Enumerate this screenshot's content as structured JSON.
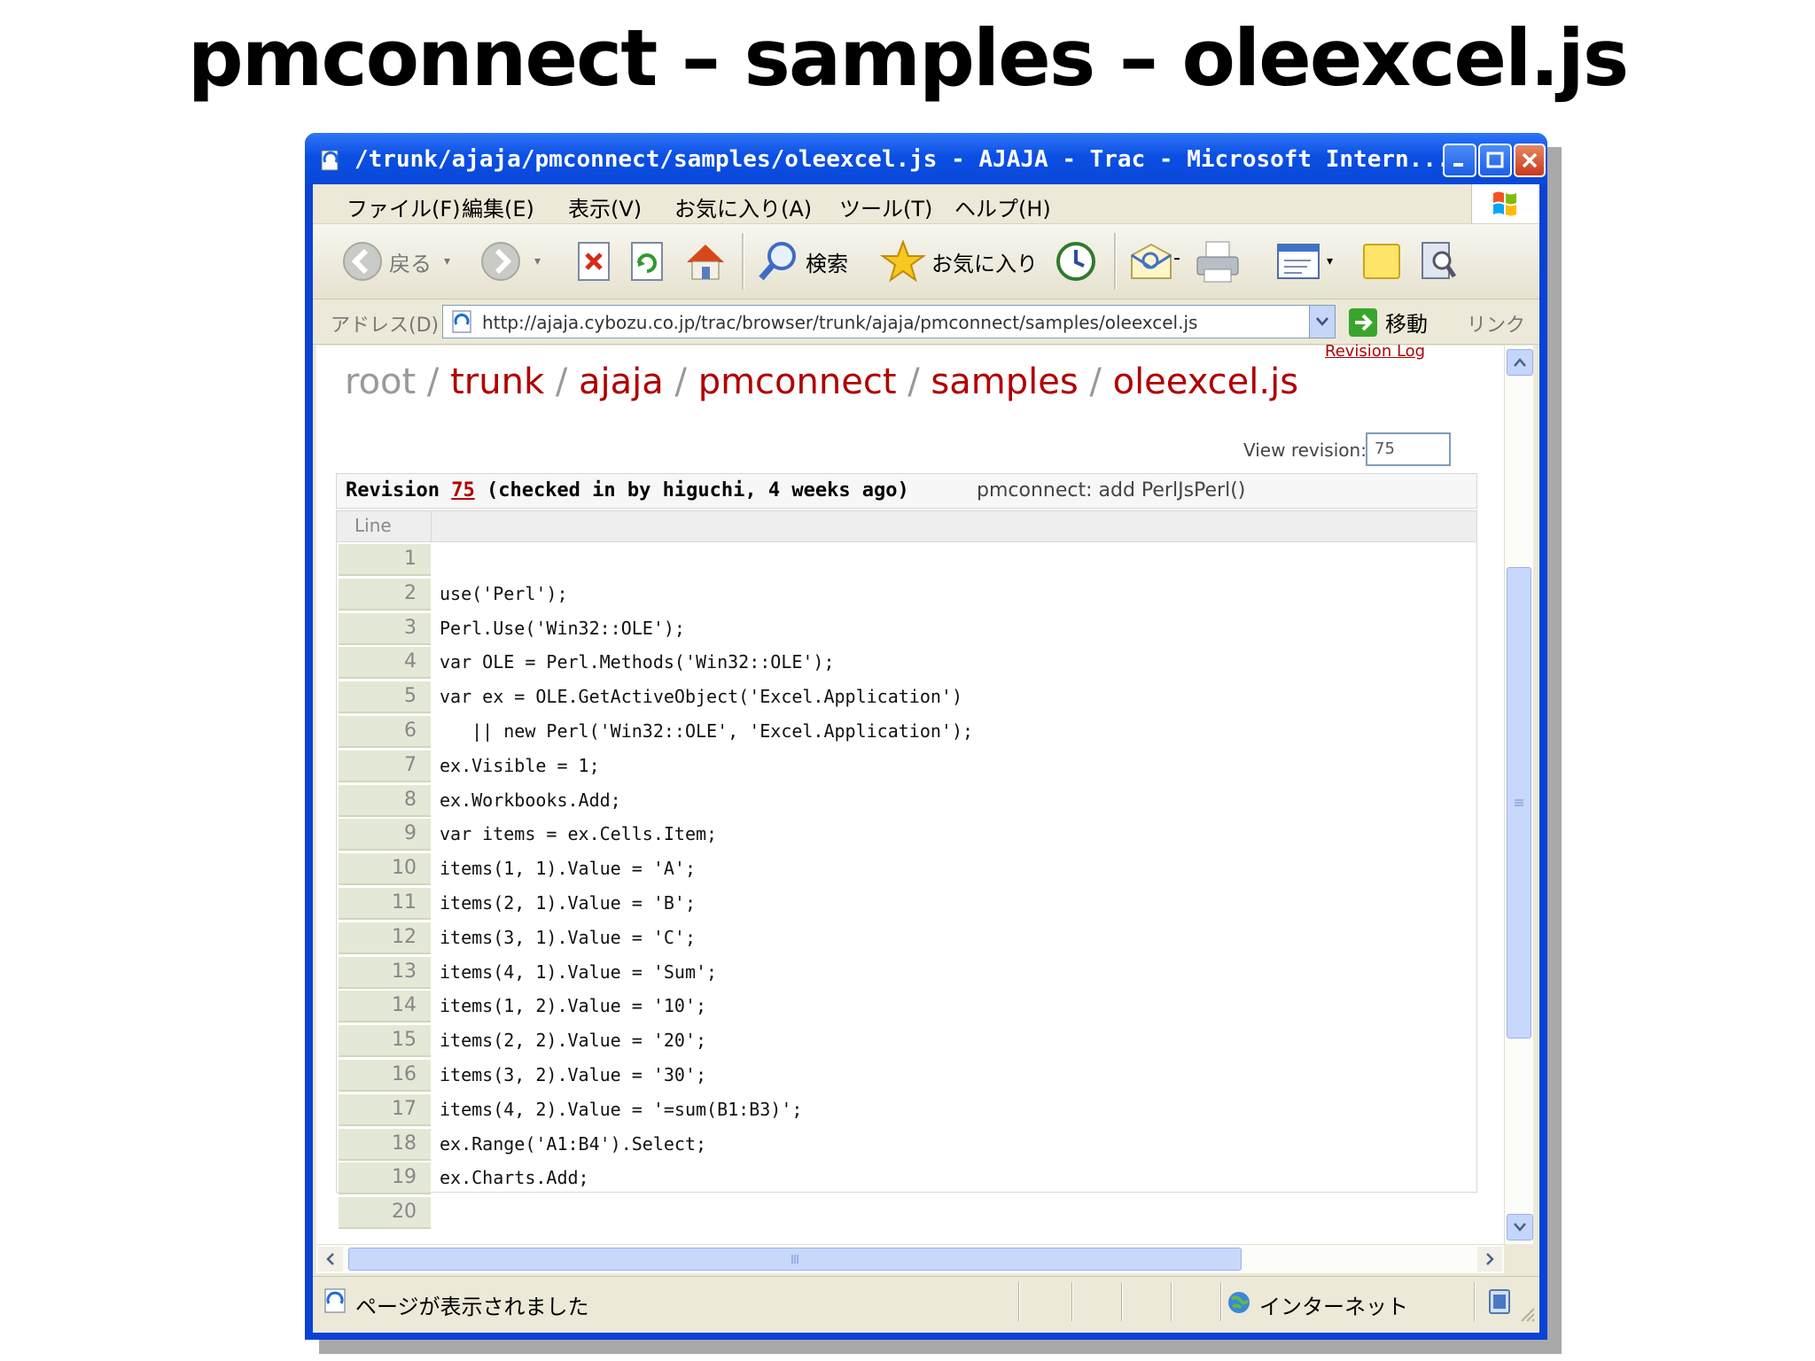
{
  "slide": {
    "title": "pmconnect – samples – oleexcel.js"
  },
  "window": {
    "title": "/trunk/ajaja/pmconnect/samples/oleexcel.js - AJAJA - Trac - Microsoft Intern...",
    "controls": {
      "minimize": "_",
      "maximize": "□",
      "close": "✕"
    }
  },
  "menu": {
    "file": "ファイル(F)",
    "edit": "編集(E)",
    "view": "表示(V)",
    "favorites": "お気に入り(A)",
    "tools": "ツール(T)",
    "help": "ヘルプ(H)"
  },
  "toolbar": {
    "back": "戻る",
    "search": "検索",
    "favorites": "お気に入り"
  },
  "address": {
    "label": "アドレス(D)",
    "url": "http://ajaja.cybozu.co.jp/trac/browser/trunk/ajaja/pmconnect/samples/oleexcel.js",
    "go": "移動",
    "links": "リンク"
  },
  "trac": {
    "revision_log": "Revision Log",
    "breadcrumb": {
      "root": "root",
      "sep": " / ",
      "trunk": "trunk",
      "ajaja": "ajaja",
      "pmconnect": "pmconnect",
      "samples": "samples",
      "file": "oleexcel.js"
    },
    "view_revision_label": "View revision:",
    "view_revision_value": "75",
    "revision": {
      "prefix": "Revision ",
      "number": "75",
      "info": " (checked in by higuchi, 4 weeks ago)",
      "message": "pmconnect: add PerlJsPerl()"
    },
    "line_header": "Line",
    "lines": [
      {
        "n": "1",
        "code": ""
      },
      {
        "n": "2",
        "code": "use('Perl');"
      },
      {
        "n": "3",
        "code": "Perl.Use('Win32::OLE');"
      },
      {
        "n": "4",
        "code": "var OLE = Perl.Methods('Win32::OLE');"
      },
      {
        "n": "5",
        "code": "var ex = OLE.GetActiveObject('Excel.Application')"
      },
      {
        "n": "6",
        "code": "   || new Perl('Win32::OLE', 'Excel.Application');"
      },
      {
        "n": "7",
        "code": "ex.Visible = 1;"
      },
      {
        "n": "8",
        "code": "ex.Workbooks.Add;"
      },
      {
        "n": "9",
        "code": "var items = ex.Cells.Item;"
      },
      {
        "n": "10",
        "code": "items(1, 1).Value = 'A';"
      },
      {
        "n": "11",
        "code": "items(2, 1).Value = 'B';"
      },
      {
        "n": "12",
        "code": "items(3, 1).Value = 'C';"
      },
      {
        "n": "13",
        "code": "items(4, 1).Value = 'Sum';"
      },
      {
        "n": "14",
        "code": "items(1, 2).Value = '10';"
      },
      {
        "n": "15",
        "code": "items(2, 2).Value = '20';"
      },
      {
        "n": "16",
        "code": "items(3, 2).Value = '30';"
      },
      {
        "n": "17",
        "code": "items(4, 2).Value = '=sum(B1:B3)';"
      },
      {
        "n": "18",
        "code": "ex.Range('A1:B4').Select;"
      },
      {
        "n": "19",
        "code": "ex.Charts.Add;"
      },
      {
        "n": "20",
        "code": ""
      }
    ]
  },
  "status": {
    "text": "ページが表示されました",
    "zone": "インターネット"
  }
}
